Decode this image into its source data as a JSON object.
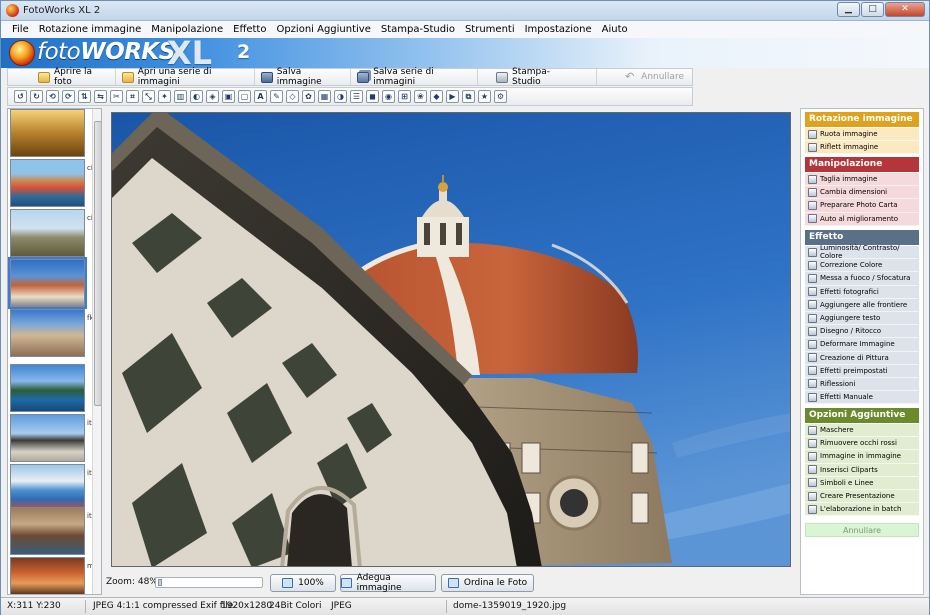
{
  "window": {
    "title": "FotoWorks XL 2",
    "controls": {
      "minimize": "▁",
      "maximize": "□",
      "close": "✕"
    }
  },
  "menu": [
    "File",
    "Rotazione immagine",
    "Manipolazione",
    "Effetto",
    "Opzioni Aggiuntive",
    "Stampa-Studio",
    "Strumenti",
    "Impostazione",
    "Aiuto"
  ],
  "logo": {
    "foto": "foto",
    "works": "WORKS",
    "xl": "XL",
    "version": "2"
  },
  "toolbar": {
    "open_photo": "Aprire la foto",
    "open_series": "Apri una serie di immagini",
    "save_image": "Salva immagine",
    "save_series": "Salva serie di immagini",
    "print_studio": "Stampa-Studio",
    "undo": "Annullare"
  },
  "tools": [
    "rotate-left-icon",
    "rotate-right-icon",
    "rotate-ccw-icon",
    "rotate-cw-icon",
    "flip-icon",
    "mirror-icon",
    "cut-icon",
    "crop-icon",
    "resize-icon",
    "wand-icon",
    "levels-icon",
    "color-icon",
    "sharpen-icon",
    "photo-effect-icon",
    "frame-icon",
    "text-icon",
    "draw-icon",
    "deform-icon",
    "paint-icon",
    "preset-icon",
    "reflect-icon",
    "manual-icon",
    "mask-icon",
    "redeye-icon",
    "insert-image-icon",
    "clipart-icon",
    "symbol-icon",
    "presentation-icon",
    "batch-icon",
    "star-icon",
    "settings-icon"
  ],
  "thumbnails": [
    {
      "caption": ""
    },
    {
      "caption": "ci"
    },
    {
      "caption": "ci"
    },
    {
      "caption": ""
    },
    {
      "caption": "fk"
    },
    {
      "caption": ""
    },
    {
      "caption": "ita"
    },
    {
      "caption": "ita"
    },
    {
      "caption": "ita"
    },
    {
      "caption": "m"
    }
  ],
  "zoom": {
    "label": "Zoom: 48%",
    "level": 0.48,
    "btn_100": "100%",
    "btn_fit": "Adegua immagine",
    "btn_sort": "Ordina le Foto"
  },
  "status": {
    "coords": "X:311 Y:230",
    "format": "JPEG 4:1:1 compressed Exif file",
    "size": "1920x1280",
    "colors": "24Bit Colori",
    "type": "JPEG",
    "filename": "dome-1359019_1920.jpg"
  },
  "panel": {
    "groups": [
      {
        "title": "Rotazione immagine",
        "header_color": "#e0a21a",
        "body_color": "#fbe9c2",
        "items": [
          "Ruota immagine",
          "Riflett immagine"
        ]
      },
      {
        "title": "Manipolazione",
        "header_color": "#b5363a",
        "body_color": "#f6d9da",
        "items": [
          "Taglia immagine",
          "Cambia dimensioni",
          "Preparare Photo Carta",
          "Auto al miglioramento"
        ]
      },
      {
        "title": "Effetto",
        "header_color": "#5a6f88",
        "body_color": "#dde3ea",
        "items": [
          "Luminosità/ Contrasto/ Colore",
          "Correzione Colore",
          "Messa a fuoco / Sfocatura",
          "Effetti fotografici",
          "Aggiungere alle frontiere",
          "Aggiungere testo",
          "Disegno / Ritocco",
          "Deformare Immagine",
          "Creazione di Pittura",
          "Effetti preimpostati",
          "Riflessioni",
          "Effetti Manuale"
        ]
      },
      {
        "title": "Opzioni Aggiuntive",
        "header_color": "#6a8a2c",
        "body_color": "#e2ecd0",
        "items": [
          "Maschere",
          "Rimuovere occhi rossi",
          "Immagine in immagine",
          "Inserisci Cliparts",
          "Simboli e Linee",
          "Creare Presentazione",
          "L'elaborazione in batch"
        ]
      }
    ],
    "undo": "Annullare"
  }
}
